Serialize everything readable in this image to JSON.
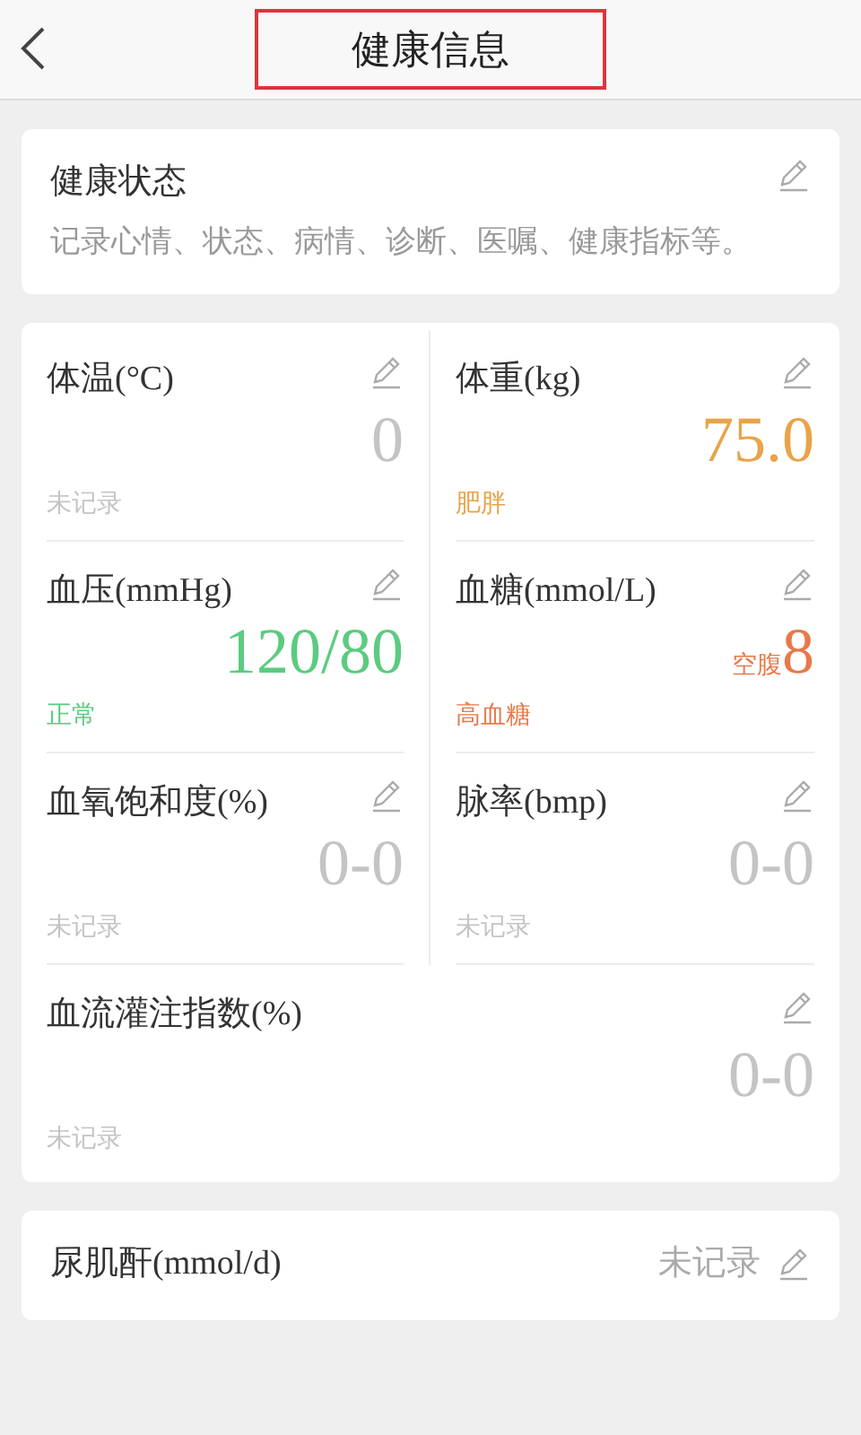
{
  "header": {
    "title": "健康信息",
    "highlighted": true
  },
  "status_card": {
    "title": "健康状态",
    "description": "记录心情、状态、病情、诊断、医嘱、健康指标等。"
  },
  "metrics": [
    {
      "kind": "half",
      "label": "体温(°C)",
      "value": "0",
      "status": "未记录",
      "color": "#c4c4c4"
    },
    {
      "kind": "half",
      "label": "体重(kg)",
      "value": "75.0",
      "status": "肥胖",
      "color": "#e9a349"
    },
    {
      "kind": "half",
      "label": "血压(mmHg)",
      "value": "120/80",
      "status": "正常",
      "color": "#5ccb80"
    },
    {
      "kind": "half",
      "label": "血糖(mmol/L)",
      "qualifier": "空腹",
      "value": "8",
      "status": "高血糖",
      "color": "#e8794a"
    },
    {
      "kind": "half",
      "label": "血氧饱和度(%)",
      "value": "0-0",
      "status": "未记录",
      "color": "#c4c4c4"
    },
    {
      "kind": "half",
      "label": "脉率(bmp)",
      "value": "0-0",
      "status": "未记录",
      "color": "#c4c4c4"
    },
    {
      "kind": "full",
      "label": "血流灌注指数(%)",
      "value": "0-0",
      "status": "未记录",
      "color": "#c4c4c4"
    }
  ],
  "bottom_card": {
    "label": "尿肌酐(mmol/d)",
    "value": "未记录"
  }
}
